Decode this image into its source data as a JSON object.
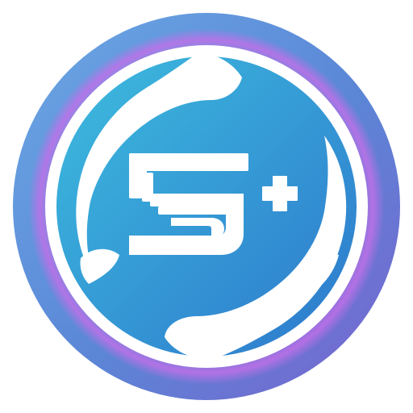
{
  "logo": {
    "icon_name": "s-plus-logo-icon",
    "mark_letter": "S",
    "mark_symbol": "+",
    "colors": {
      "ring_outer": "#6f86d8",
      "ring_inner": "#c070e8",
      "ring_blue": "#4a8fe0",
      "disc_light": "#3ab4dc",
      "disc_dark": "#2f7fd0",
      "swoosh": "#ffffff",
      "glyph": "#ffffff",
      "background": "#ffffff"
    }
  }
}
